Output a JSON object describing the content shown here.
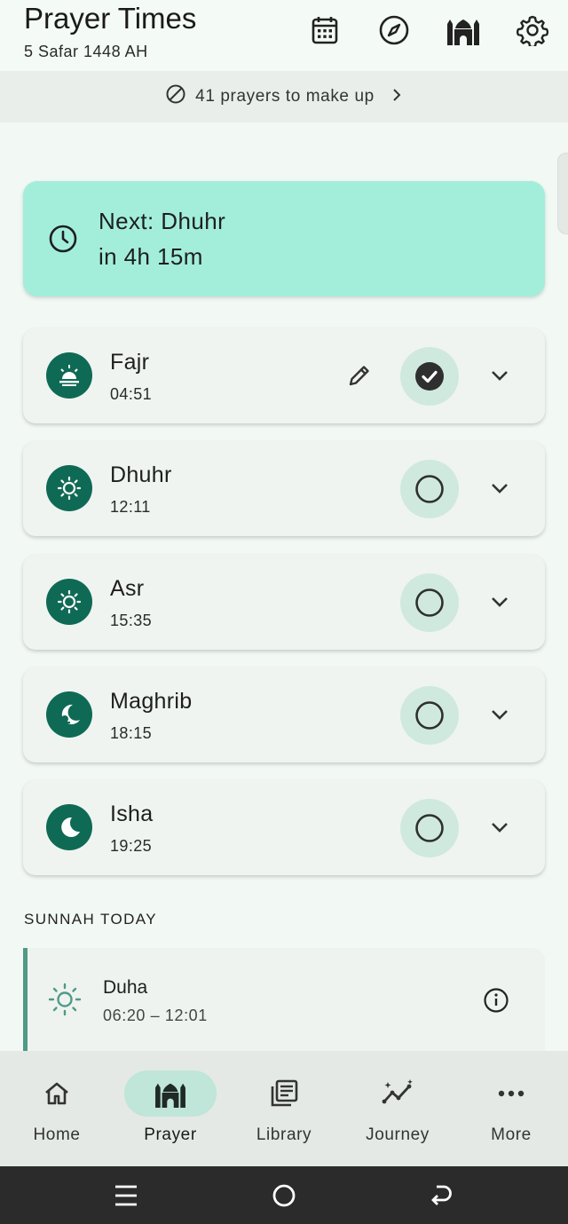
{
  "header": {
    "title": "Prayer Times",
    "hijri_date": "5 Safar 1448 AH",
    "icons": [
      "calendar-icon",
      "compass-icon",
      "mosque-icon",
      "gear-icon"
    ]
  },
  "makeup_banner": {
    "text": "41 prayers to make up"
  },
  "next_prayer": {
    "label": "Next: Dhuhr",
    "countdown": "in 4h 15m"
  },
  "prayers": [
    {
      "name": "Fajr",
      "time": "04:51",
      "icon": "sunrise-icon",
      "completed": true
    },
    {
      "name": "Dhuhr",
      "time": "12:11",
      "icon": "sun-icon",
      "completed": false
    },
    {
      "name": "Asr",
      "time": "15:35",
      "icon": "sun-icon",
      "completed": false
    },
    {
      "name": "Maghrib",
      "time": "18:15",
      "icon": "sunset-icon",
      "completed": false
    },
    {
      "name": "Isha",
      "time": "19:25",
      "icon": "moon-icon",
      "completed": false
    }
  ],
  "sunnah": {
    "section_title": "SUNNAH TODAY",
    "items": [
      {
        "name": "Duha",
        "time_range": "06:20 – 12:01",
        "icon": "sun-outline-icon"
      }
    ]
  },
  "bottom_nav": {
    "items": [
      {
        "label": "Home",
        "icon": "home-icon",
        "active": false
      },
      {
        "label": "Prayer",
        "icon": "mosque-icon",
        "active": true
      },
      {
        "label": "Library",
        "icon": "library-icon",
        "active": false
      },
      {
        "label": "Journey",
        "icon": "journey-icon",
        "active": false
      },
      {
        "label": "More",
        "icon": "more-icon",
        "active": false
      }
    ]
  },
  "colors": {
    "accent_dark": "#0f6a55",
    "next_card": "#a2eedb",
    "check_bg": "#cfe9df",
    "background": "#f2f8f4"
  }
}
